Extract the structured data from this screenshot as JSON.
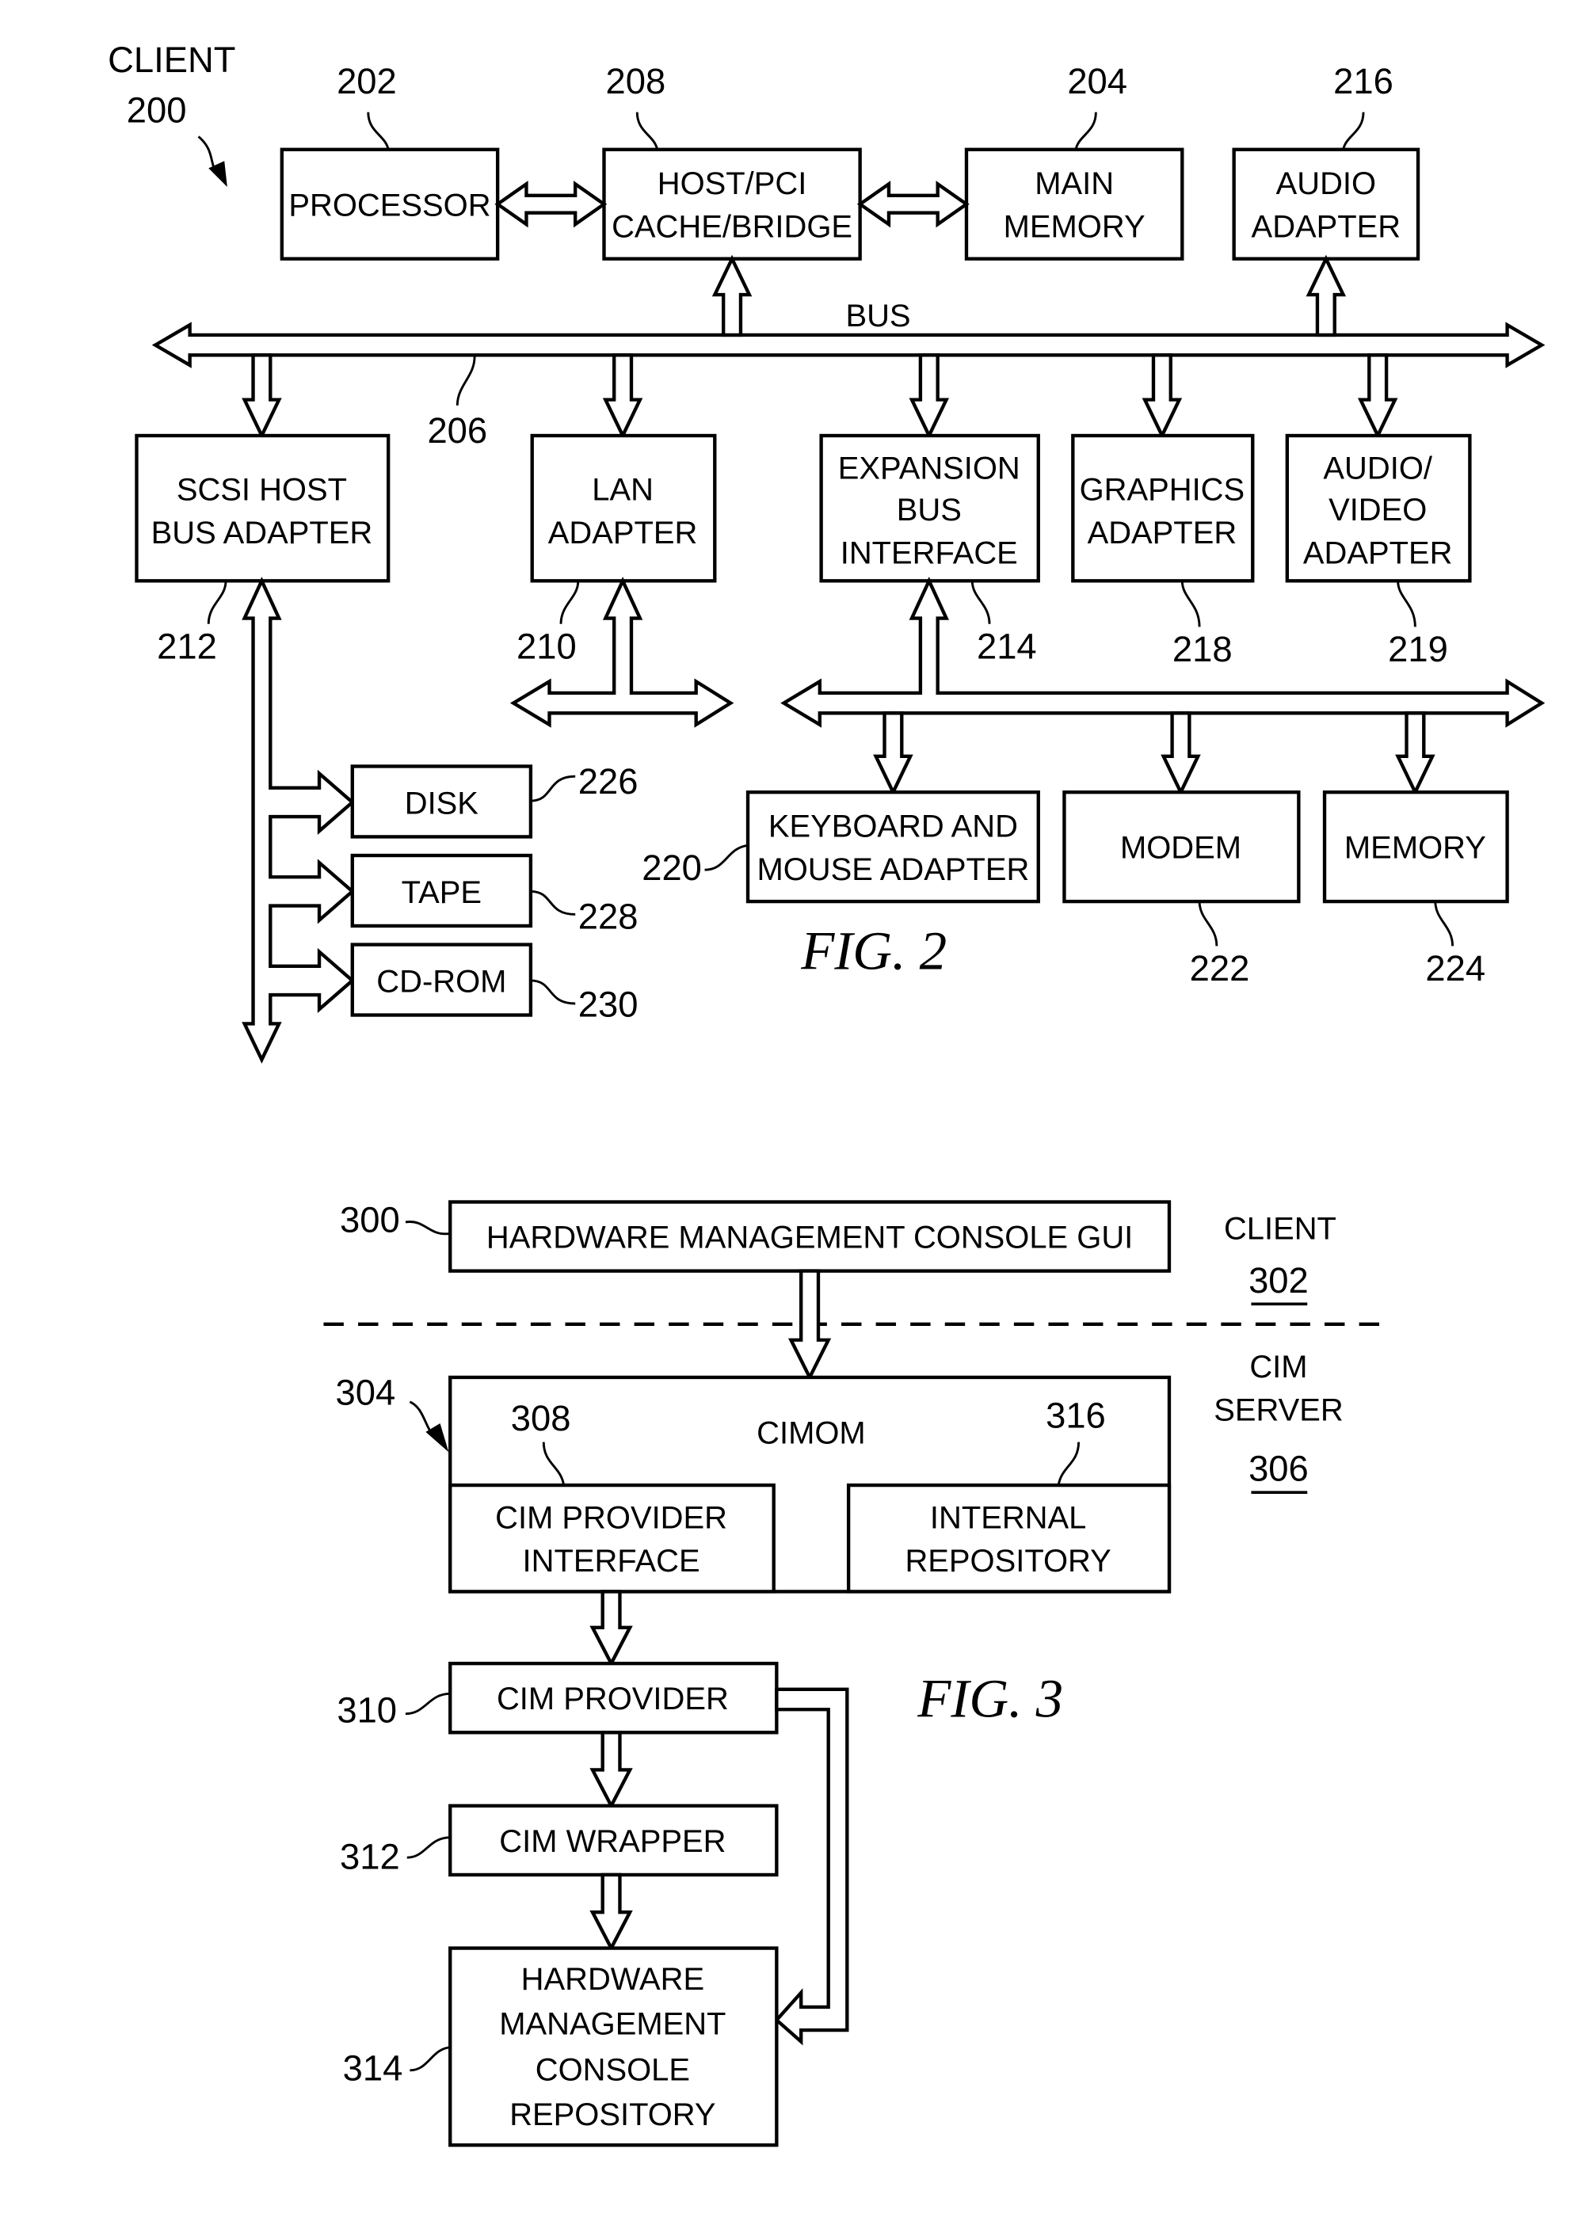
{
  "fig2": {
    "caption": "FIG. 2",
    "client_label": "CLIENT",
    "client_ref": "200",
    "bus_label": "BUS",
    "bus_ref": "206",
    "components": {
      "processor": {
        "ref": "202",
        "lines": [
          "PROCESSOR"
        ]
      },
      "host_pci": {
        "ref": "208",
        "lines": [
          "HOST/PCI",
          "CACHE/BRIDGE"
        ]
      },
      "main_memory": {
        "ref": "204",
        "lines": [
          "MAIN",
          "MEMORY"
        ]
      },
      "audio_adapter": {
        "ref": "216",
        "lines": [
          "AUDIO",
          "ADAPTER"
        ]
      },
      "scsi": {
        "ref": "212",
        "lines": [
          "SCSI HOST",
          "BUS ADAPTER"
        ]
      },
      "lan": {
        "ref": "210",
        "lines": [
          "LAN",
          "ADAPTER"
        ]
      },
      "expansion": {
        "ref": "214",
        "lines": [
          "EXPANSION",
          "BUS",
          "INTERFACE"
        ]
      },
      "graphics": {
        "ref": "218",
        "lines": [
          "GRAPHICS",
          "ADAPTER"
        ]
      },
      "audio_video": {
        "ref": "219",
        "lines": [
          "AUDIO/",
          "VIDEO",
          "ADAPTER"
        ]
      },
      "keyboard": {
        "ref": "220",
        "lines": [
          "KEYBOARD AND",
          "MOUSE ADAPTER"
        ]
      },
      "modem": {
        "ref": "222",
        "lines": [
          "MODEM"
        ]
      },
      "memory": {
        "ref": "224",
        "lines": [
          "MEMORY"
        ]
      },
      "disk": {
        "ref": "226",
        "lines": [
          "DISK"
        ]
      },
      "tape": {
        "ref": "228",
        "lines": [
          "TAPE"
        ]
      },
      "cdrom": {
        "ref": "230",
        "lines": [
          "CD-ROM"
        ]
      }
    }
  },
  "fig3": {
    "caption": "FIG. 3",
    "client_label": "CLIENT",
    "client_ref": "302",
    "server_label_lines": [
      "CIM",
      "SERVER"
    ],
    "server_ref": "306",
    "components": {
      "hmc_gui": {
        "ref": "300",
        "lines": [
          "HARDWARE MANAGEMENT CONSOLE GUI"
        ]
      },
      "cimom": {
        "ref": "304",
        "lines": [
          "CIMOM"
        ]
      },
      "provider_interface": {
        "ref": "308",
        "lines": [
          "CIM PROVIDER",
          "INTERFACE"
        ]
      },
      "internal_repository": {
        "ref": "316",
        "lines": [
          "INTERNAL",
          "REPOSITORY"
        ]
      },
      "cim_provider": {
        "ref": "310",
        "lines": [
          "CIM PROVIDER"
        ]
      },
      "cim_wrapper": {
        "ref": "312",
        "lines": [
          "CIM WRAPPER"
        ]
      },
      "hmc_repository": {
        "ref": "314",
        "lines": [
          "HARDWARE",
          "MANAGEMENT",
          "CONSOLE",
          "REPOSITORY"
        ]
      }
    }
  }
}
